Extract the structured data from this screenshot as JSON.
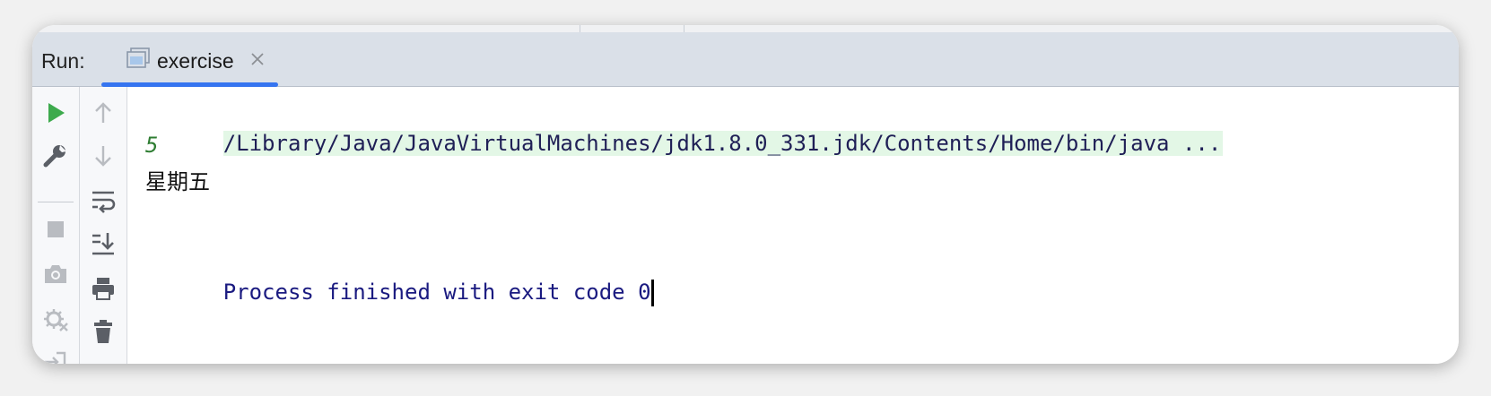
{
  "header": {
    "run_label": "Run:",
    "tab": {
      "title": "exercise"
    }
  },
  "left_toolbar": {
    "buttons": [
      {
        "name": "rerun",
        "icon": "play-icon",
        "color": "#3daa4d"
      },
      {
        "name": "edit-configuration",
        "icon": "wrench-icon"
      },
      {
        "name": "stop",
        "icon": "stop-icon"
      },
      {
        "name": "dump-threads",
        "icon": "camera-icon"
      },
      {
        "name": "settings",
        "icon": "debug-gear-icon"
      },
      {
        "name": "exit",
        "icon": "exit-icon"
      }
    ]
  },
  "console_toolbar": {
    "buttons": [
      {
        "name": "up-stack-trace",
        "icon": "arrow-up-icon"
      },
      {
        "name": "down-stack-trace",
        "icon": "arrow-down-icon"
      },
      {
        "name": "soft-wrap",
        "icon": "soft-wrap-icon"
      },
      {
        "name": "scroll-to-end",
        "icon": "scroll-to-end-icon"
      },
      {
        "name": "print",
        "icon": "print-icon"
      },
      {
        "name": "clear-all",
        "icon": "trash-icon"
      }
    ]
  },
  "console": {
    "command_line": "/Library/Java/JavaVirtualMachines/jdk1.8.0_331.jdk/Contents/Home/bin/java ...",
    "input_echo": "5",
    "output_line": "星期五",
    "blank_line": "",
    "exit_message": "Process finished with exit code 0"
  },
  "colors": {
    "accent_underline": "#3574f0",
    "command_highlight": "#e3f7e6",
    "input_text": "#2e7d32",
    "process_text": "#1a1a80"
  }
}
